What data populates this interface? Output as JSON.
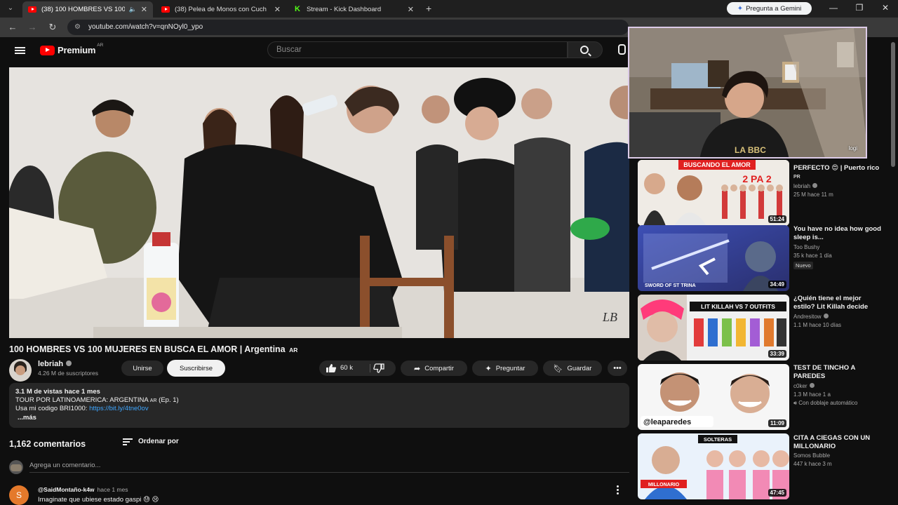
{
  "browser": {
    "tabs": [
      {
        "title": "(38) 100 HOMBRES VS 100",
        "active": true,
        "favicon": "youtube-icon"
      },
      {
        "title": "(38) Pelea de Monos con Cuch",
        "active": false,
        "favicon": "youtube-icon"
      },
      {
        "title": "Stream - Kick Dashboard",
        "active": false,
        "favicon": "kick-icon"
      }
    ],
    "gemini_label": "Pregunta a Gemini",
    "url": "youtube.com/watch?v=qnNOyl0_ypo"
  },
  "header": {
    "logo_text": "Premium",
    "logo_country": "AR",
    "search_placeholder": "Buscar"
  },
  "video": {
    "title": "100 HOMBRES VS 100 MUJERES EN BUSCA EL AMOR | Argentina",
    "title_suffix": "AR",
    "watermark": "LB"
  },
  "channel": {
    "name": "lebriah",
    "subscribers": "4.26 M de suscriptores",
    "join_label": "Unirse",
    "subscribe_label": "Suscribirse"
  },
  "actions": {
    "likes": "60 k",
    "share_label": "Compartir",
    "ask_label": "Preguntar",
    "save_label": "Guardar"
  },
  "description": {
    "stats": "3.1 M de vistas  hace 1 mes",
    "line1": "TOUR POR LATINOAMERICA: ARGENTINA",
    "line1_ar": "AR",
    "line1_tail": "(Ep. 1)",
    "line2_prefix": "Usa mi codigo BRI1000: ",
    "line2_link": "https://bit.ly/4tne0ov",
    "more_label": "...más"
  },
  "comments": {
    "count": "1,162 comentarios",
    "sort_label": "Ordenar por",
    "add_placeholder": "Agrega un comentario...",
    "items": [
      {
        "initial": "S",
        "author": "@SaidMontaño-k4w",
        "time": "hace 1 mes",
        "text": "Imaginate que ubiese estado gaspi 😓 😢"
      }
    ]
  },
  "sidebar": {
    "items": [
      {
        "title": "PERFECTO 😍 | Puerto rico",
        "title_suffix": "PR",
        "channel": "lebriah",
        "verified": true,
        "meta": "25 M  hace 11 m",
        "duration": "51:24",
        "thumb_text_top": "BUSCANDO EL AMOR",
        "thumb_text_sub": "2 PA 2",
        "badge": ""
      },
      {
        "title": "You have no idea how good sleep is...",
        "title_suffix": "",
        "channel": "Too Bushy",
        "verified": false,
        "meta": "35 k  hace 1 día",
        "duration": "34:49",
        "thumb_text_top": "SWORD OF ST TRINA",
        "thumb_text_sub": "",
        "badge": "Nuevo"
      },
      {
        "title": "¿Quién tiene el mejor estilo? Lit Killah decide",
        "title_suffix": "",
        "channel": "Andresitow",
        "verified": true,
        "meta": "1.1 M  hace 10 días",
        "duration": "33:39",
        "thumb_text_top": "LIT KILLAH VS 7 OUTFITS",
        "thumb_text_sub": "",
        "badge": ""
      },
      {
        "title": "TEST DE TINCHO A PAREDES",
        "title_suffix": "",
        "channel": "c0ker",
        "verified": true,
        "meta": "1.3 M  hace 1 a",
        "duration": "11:09",
        "thumb_text_top": "@leaparedes",
        "thumb_text_sub": "",
        "badge": "Con doblaje automático"
      },
      {
        "title": "CITA A CIEGAS CON UN MILLONARIO",
        "title_suffix": "",
        "channel": "Somos Bubble",
        "verified": false,
        "meta": "447 k  hace 3 m",
        "duration": "47:45",
        "thumb_text_top": "SOLTERAS",
        "thumb_text_sub": "MILLONARIO",
        "badge": ""
      }
    ]
  },
  "webcam": {
    "label": "logi"
  },
  "colors": {
    "background": "#0f0f0f",
    "brand_red": "#ff0000",
    "link_blue": "#3ea6ff",
    "pill": "#272727",
    "kick_green": "#53fc18",
    "webcam_border": "#dccbe8"
  }
}
